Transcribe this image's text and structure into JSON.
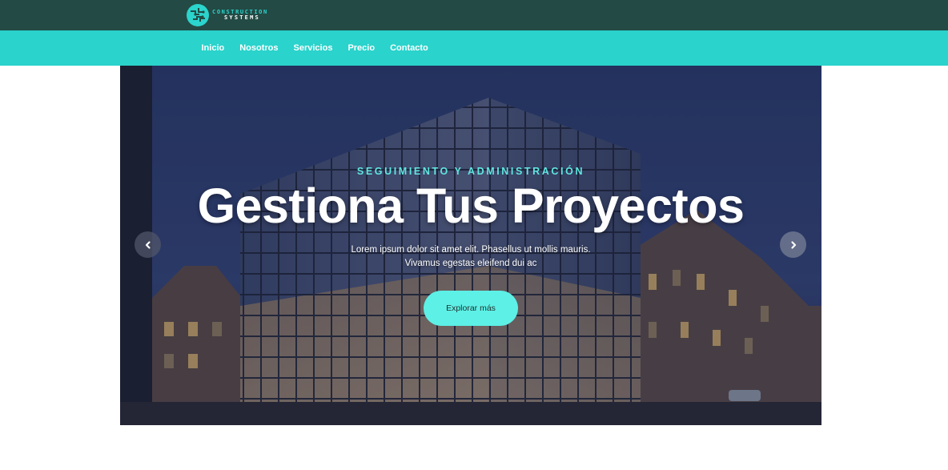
{
  "brand": {
    "logo_line1": "CONSTRUCTION",
    "logo_line2": "SYSTEMS",
    "logo_icon": "circuit-globe-icon",
    "colors": {
      "topbar": "#234a45",
      "navbar": "#2ad3cb",
      "accent": "#5df0e6"
    }
  },
  "nav": {
    "items": [
      {
        "label": "Inicio"
      },
      {
        "label": "Nosotros"
      },
      {
        "label": "Servicios"
      },
      {
        "label": "Precio"
      },
      {
        "label": "Contacto"
      }
    ]
  },
  "hero": {
    "kicker": "SEGUIMIENTO Y ADMINISTRACIÓN",
    "headline": "Gestiona Tus Proyectos",
    "lede_line1": "Lorem ipsum dolor sit amet elit. Phasellus ut mollis mauris.",
    "lede_line2": "Vivamus egestas eleifend dui ac",
    "cta_label": "Explorar más",
    "prev_icon": "chevron-left-icon",
    "next_icon": "chevron-right-icon"
  }
}
